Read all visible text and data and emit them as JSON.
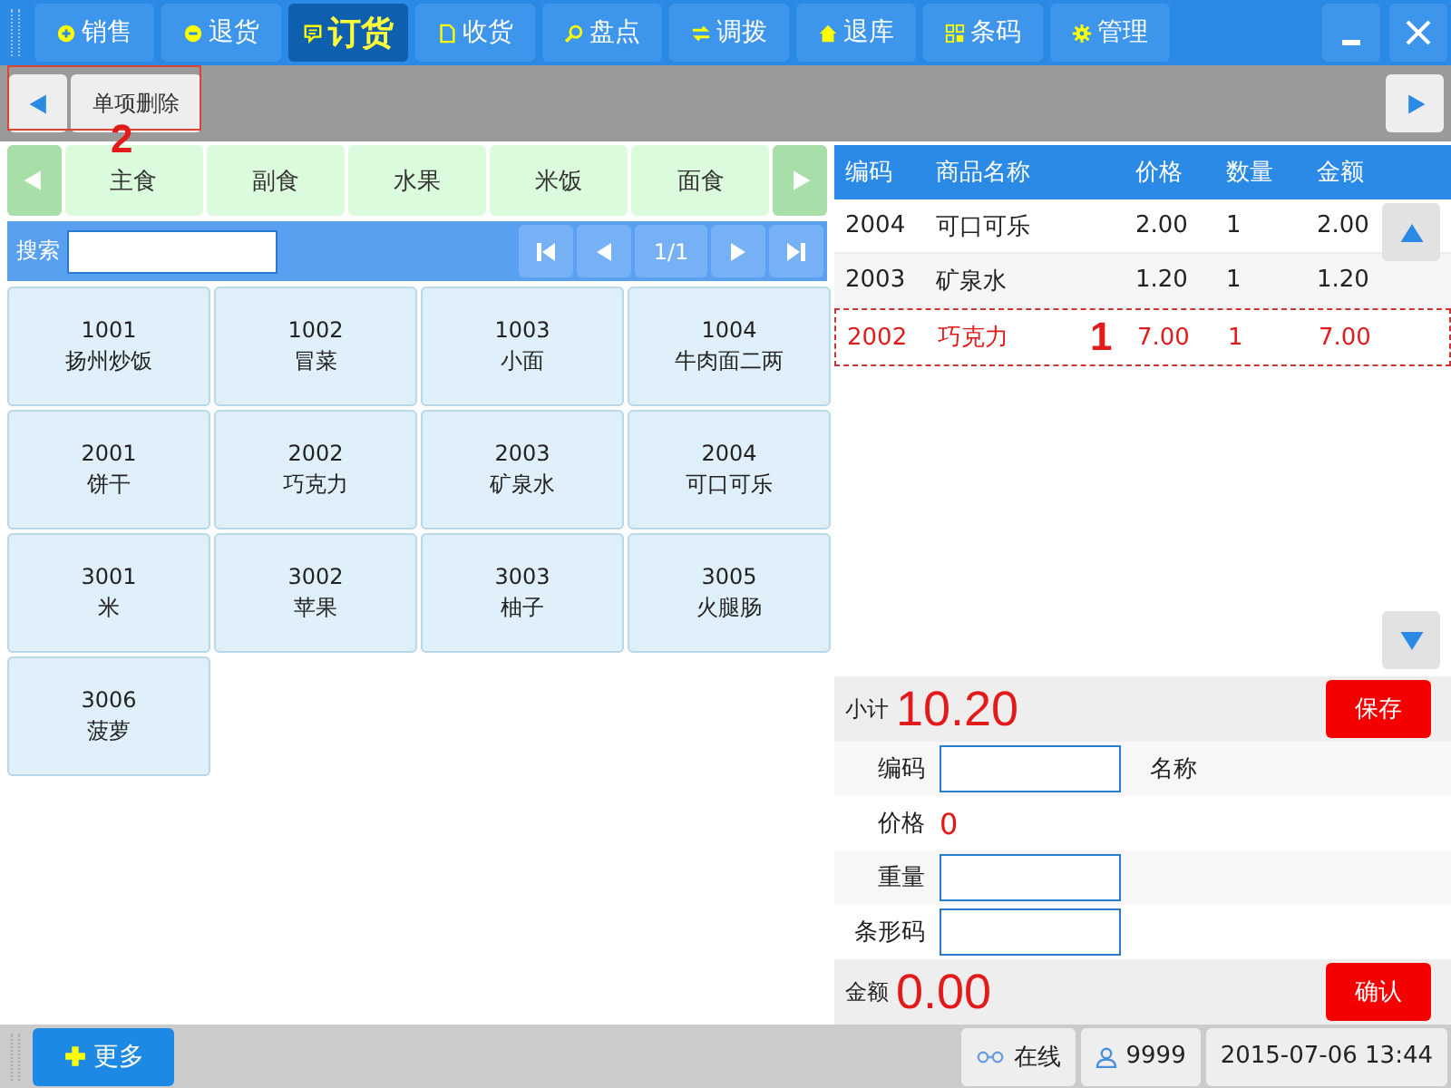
{
  "nav_tabs": [
    {
      "kind": "plus",
      "label": "销售",
      "selected": false
    },
    {
      "kind": "minus",
      "label": "退货",
      "selected": false
    },
    {
      "kind": "chat",
      "label": "订货",
      "selected": true
    },
    {
      "kind": "doc",
      "label": "收货",
      "selected": false
    },
    {
      "kind": "search",
      "label": "盘点",
      "selected": false
    },
    {
      "kind": "swap",
      "label": "调拨",
      "selected": false
    },
    {
      "kind": "home",
      "label": "退库",
      "selected": false
    },
    {
      "kind": "grid",
      "label": "条码",
      "selected": false
    },
    {
      "kind": "gear",
      "label": "管理",
      "selected": false
    }
  ],
  "toolbar": {
    "delete_button": "单项删除"
  },
  "categories": [
    "主食",
    "副食",
    "水果",
    "米饭",
    "面食"
  ],
  "search": {
    "label": "搜索"
  },
  "pager": {
    "page": "1/1"
  },
  "products": [
    {
      "code": "1001",
      "name": "扬州炒饭"
    },
    {
      "code": "1002",
      "name": "冒菜"
    },
    {
      "code": "1003",
      "name": "小面"
    },
    {
      "code": "1004",
      "name": "牛肉面二两"
    },
    {
      "code": "2001",
      "name": "饼干"
    },
    {
      "code": "2002",
      "name": "巧克力"
    },
    {
      "code": "2003",
      "name": "矿泉水"
    },
    {
      "code": "2004",
      "name": "可口可乐"
    },
    {
      "code": "3001",
      "name": "米"
    },
    {
      "code": "3002",
      "name": "苹果"
    },
    {
      "code": "3003",
      "name": "柚子"
    },
    {
      "code": "3005",
      "name": "火腿肠"
    },
    {
      "code": "3006",
      "name": "菠萝"
    }
  ],
  "order_table": {
    "columns": [
      "编码",
      "商品名称",
      "价格",
      "数量",
      "金额"
    ],
    "rows": [
      {
        "code": "2004",
        "name": "可口可乐",
        "price": "2.00",
        "qty": "1",
        "amount": "2.00",
        "selected": false
      },
      {
        "code": "2003",
        "name": "矿泉水",
        "price": "1.20",
        "qty": "1",
        "amount": "1.20",
        "selected": false
      },
      {
        "code": "2002",
        "name": "巧克力",
        "price": "7.00",
        "qty": "1",
        "amount": "7.00",
        "selected": true
      }
    ]
  },
  "subtotal": {
    "label": "小计",
    "value": "10.20",
    "button": "保存"
  },
  "form": [
    {
      "kind": "input",
      "label": "编码",
      "extra": "名称"
    },
    {
      "kind": "value",
      "label": "价格",
      "value": "0"
    },
    {
      "kind": "input",
      "label": "重量"
    },
    {
      "kind": "input",
      "label": "条形码"
    }
  ],
  "amount": {
    "label": "金额",
    "value": "0.00",
    "button": "确认"
  },
  "annotations": [
    "1",
    "2"
  ],
  "status_bar": {
    "more": "更多",
    "connection": "在线",
    "user": "9999",
    "datetime": "2015-07-06 13:44"
  }
}
